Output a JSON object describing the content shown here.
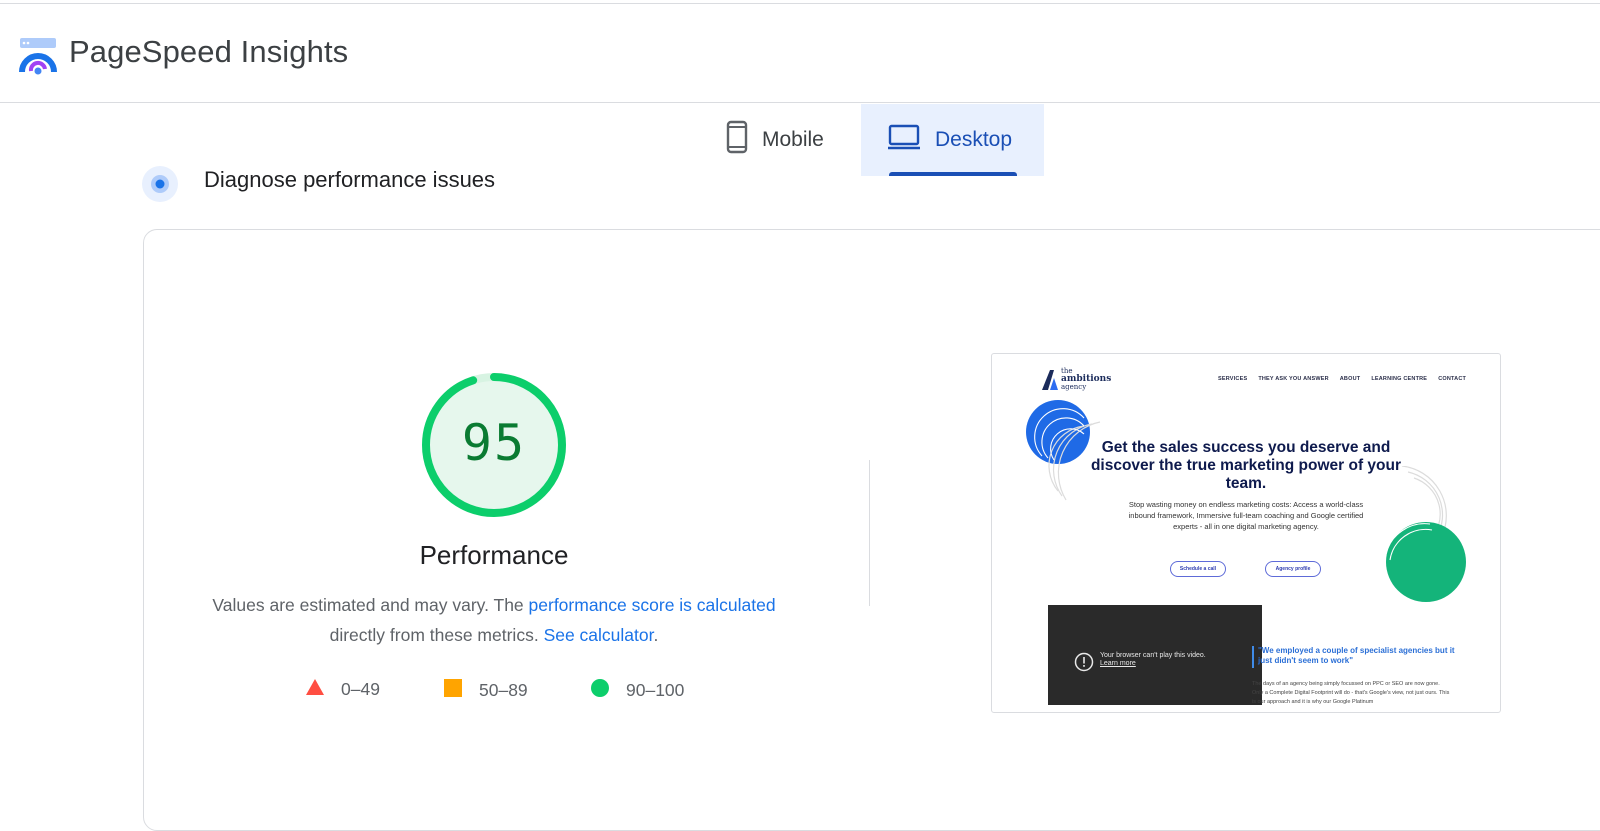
{
  "app": {
    "title": "PageSpeed Insights"
  },
  "device_tabs": [
    {
      "label": "Mobile",
      "icon": "phone-icon",
      "selected": false
    },
    {
      "label": "Desktop",
      "icon": "laptop-icon",
      "selected": true
    }
  ],
  "section": {
    "title": "Diagnose performance issues"
  },
  "score": {
    "value": "95",
    "fraction": 0.95,
    "category": "Performance",
    "color": "#0cce6b"
  },
  "note": {
    "text_before": "Values are estimated and may vary. The ",
    "link_score": "performance score is calculated",
    "text_middle": " directly from these metrics. ",
    "link_calc": "See calculator",
    "text_after": "."
  },
  "legend": [
    {
      "range": "0–49",
      "shape": "triangle",
      "color": "#ff4e42"
    },
    {
      "range": "50–89",
      "shape": "square",
      "color": "#ffa400"
    },
    {
      "range": "90–100",
      "shape": "circle",
      "color": "#0cce6b"
    }
  ],
  "screenshot": {
    "logo": {
      "line1": "the",
      "line2": "ambitions",
      "line3": "agency"
    },
    "nav": [
      "SERVICES",
      "THEY ASK YOU ANSWER",
      "ABOUT",
      "LEARNING CENTRE",
      "CONTACT"
    ],
    "hero": "Get the sales success you deserve and discover the true marketing power of your team.",
    "sub": "Stop wasting money on endless marketing costs: Access a world-class inbound framework, Immersive full-team coaching and Google certified experts - all in one digital marketing agency.",
    "buttons": [
      "Schedule a call",
      "Agency profile"
    ],
    "video": {
      "line1": "Your browser can't play this video.",
      "line2": "Learn more"
    },
    "quote": "\"We employed a couple of specialist agencies but it just didn't seem to work\"",
    "body": "The days of an agency being simply focussed on PPC or SEO are now gone. Only a Complete Digital Footprint will do - that's Google's view, not just ours. This is our approach and it is why our Google Platinum"
  }
}
